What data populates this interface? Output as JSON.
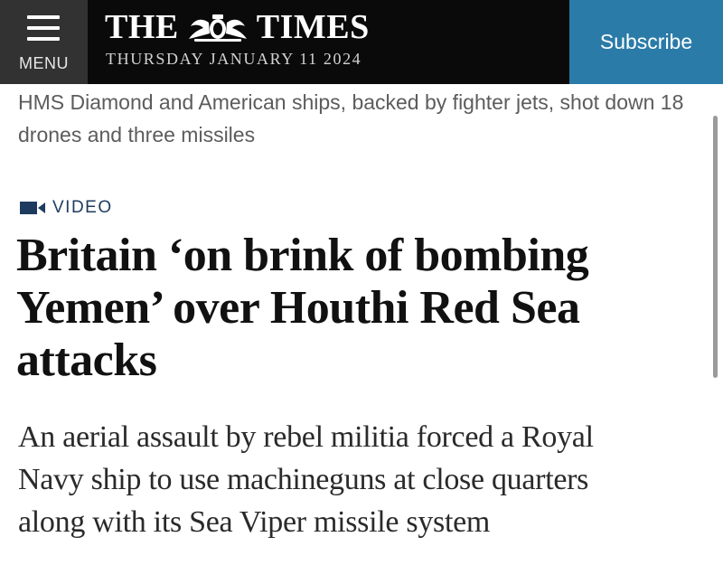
{
  "header": {
    "menu_label": "MENU",
    "brand_left": "THE",
    "brand_right": "TIMES",
    "date": "THURSDAY JANUARY 11 2024",
    "subscribe_label": "Subscribe",
    "menu_bg": "#323232",
    "subscribe_bg": "#2a7ba8"
  },
  "previous_article": {
    "standfirst": "HMS Diamond and American ships, backed by fighter jets, shot down 18 drones and three missiles"
  },
  "article": {
    "tag_icon": "video-camera-icon",
    "tag_label": "VIDEO",
    "headline_lines": [
      "Britain ‘on brink of bombing",
      "Yemen’ over Houthi Red Sea",
      "attacks"
    ],
    "standfirst_lines": [
      "An aerial assault by rebel militia forced a Royal",
      "Navy ship to use machineguns at close quarters",
      "along with its Sea Viper missile system"
    ]
  }
}
